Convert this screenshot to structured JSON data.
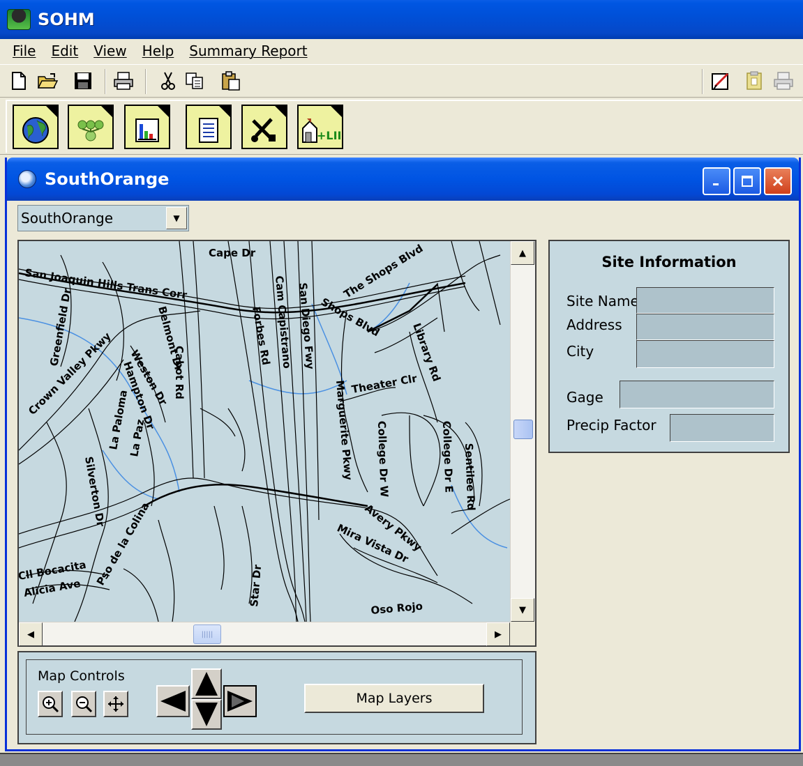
{
  "app": {
    "title": "SOHM"
  },
  "menu": {
    "items": [
      "File",
      "Edit",
      "View",
      "Help",
      "Summary Report"
    ]
  },
  "child_window": {
    "title": "SouthOrange",
    "dropdown_value": "SouthOrange"
  },
  "map": {
    "street_labels": [
      "Cape Dr",
      "San Joaquin Hills Trans Corr",
      "The Shops Blvd",
      "Shops Blvd",
      "Library Rd",
      "Greenfield Dr",
      "Crown Valley Pkwy",
      "Weston Dr",
      "Hampton Dr",
      "Belmont Dr",
      "Cabot Rd",
      "Forbes Rd",
      "Cam Capistrano",
      "San Diego Fwy",
      "Marguerite Pkwy",
      "Theater Clr",
      "College Dr W",
      "College Dr E",
      "Sentilee Rd",
      "La Paloma",
      "La Paz",
      "Silverton Dr",
      "Avery Pkwy",
      "Mira Vista Dr",
      "Star Dr",
      "Oso Rojo",
      "Pso de la Colina",
      "Alicia Ave",
      "Cll Bocacita"
    ]
  },
  "site_info": {
    "title": "Site Information",
    "site_name_label": "Site Name",
    "address_label": "Address",
    "city_label": "City",
    "gage_label": "Gage",
    "precip_label": "Precip Factor"
  },
  "map_controls": {
    "label": "Map Controls",
    "layers_button": "Map Layers"
  },
  "colors": {
    "titlebar": "#0054e3",
    "panel": "#c6d9e0",
    "toolbar_button": "#eef2a0",
    "map_stream": "#4a90e2"
  }
}
